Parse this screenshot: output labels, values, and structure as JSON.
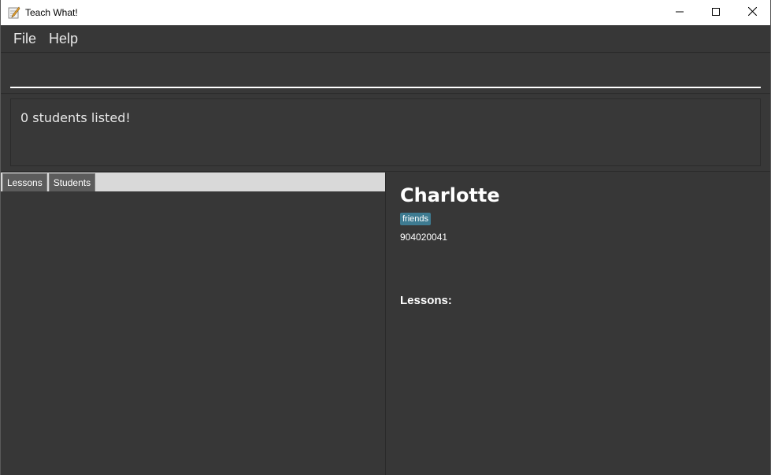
{
  "window": {
    "title": "Teach What!",
    "icon": "notepad-pencil-icon"
  },
  "window_controls": {
    "minimize_icon": "minimize-icon",
    "maximize_icon": "maximize-icon",
    "close_icon": "close-icon"
  },
  "menu": {
    "items": [
      {
        "label": "File"
      },
      {
        "label": "Help"
      }
    ]
  },
  "command": {
    "value": "",
    "placeholder": ""
  },
  "result": {
    "text": "0 students listed!"
  },
  "tabs": [
    {
      "label": "Lessons"
    },
    {
      "label": "Students"
    }
  ],
  "detail": {
    "name": "Charlotte",
    "tags": [
      "friends"
    ],
    "phone": "904020041",
    "lessons_heading": "Lessons:"
  },
  "colors": {
    "background": "#373737",
    "tag": "#3e7b91",
    "tab_bar": "#d9d9d9",
    "tab": "#5c5c5c"
  }
}
